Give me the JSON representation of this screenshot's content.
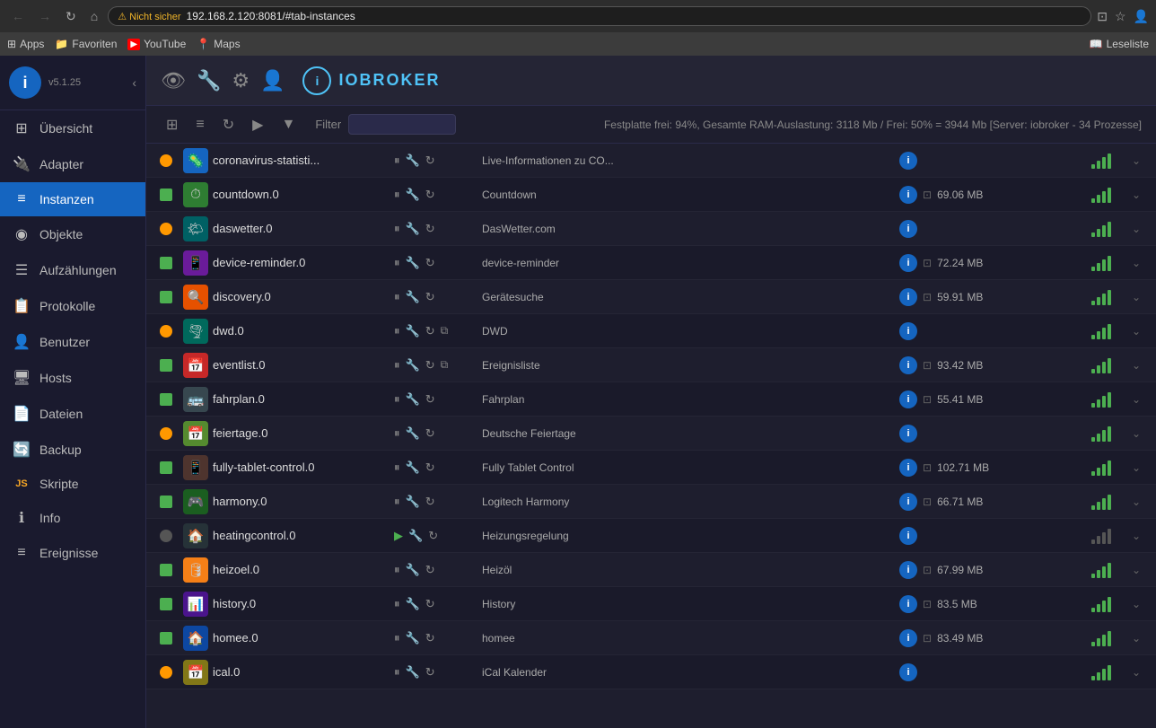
{
  "browser": {
    "back_disabled": true,
    "forward_disabled": true,
    "url": "192.168.2.120:8081/#tab-instances",
    "warning": "Nicht sicher",
    "bookmarks": [
      {
        "label": "Apps",
        "icon": "⊞",
        "color": "#555"
      },
      {
        "label": "Favoriten",
        "icon": "📁",
        "color": "#f9a825"
      },
      {
        "label": "YouTube",
        "icon": "▶",
        "color": "#ff0000"
      },
      {
        "label": "Maps",
        "icon": "📍",
        "color": "#4caf50"
      }
    ],
    "readlist_label": "Leseliste"
  },
  "sidebar": {
    "version": "v5.1.25",
    "items": [
      {
        "label": "Übersicht",
        "icon": "⊞"
      },
      {
        "label": "Adapter",
        "icon": "🔌"
      },
      {
        "label": "Instanzen",
        "icon": "≡",
        "active": true
      },
      {
        "label": "Objekte",
        "icon": "◉"
      },
      {
        "label": "Aufzählungen",
        "icon": "☰"
      },
      {
        "label": "Protokolle",
        "icon": "📋"
      },
      {
        "label": "Benutzer",
        "icon": "👤"
      },
      {
        "label": "Hosts",
        "icon": "🖥"
      },
      {
        "label": "Dateien",
        "icon": "📄"
      },
      {
        "label": "Backup",
        "icon": "🔄"
      },
      {
        "label": "Skripte",
        "icon": "JS"
      },
      {
        "label": "Info",
        "icon": "ℹ"
      },
      {
        "label": "Ereignisse",
        "icon": "≡"
      }
    ]
  },
  "topbar": {
    "icons": [
      "👁",
      "🔧",
      "⚙",
      "👤"
    ],
    "brand_letter": "i",
    "brand_name": "IOBROKER"
  },
  "toolbar": {
    "status_text": "Festplatte frei: 94%, Gesamte RAM-Auslastung: 3118 Mb / Frei: 50% = 3944 Mb [Server: iobroker - 34 Prozesse]",
    "filter_label": "Filter"
  },
  "instances": [
    {
      "status": "orange",
      "name": "coronavirus-statisti...",
      "title": "Live-Informationen zu CO...",
      "ram": "",
      "has_link": false,
      "row_alt": false
    },
    {
      "status": "green",
      "name": "countdown.0",
      "title": "Countdown",
      "ram": "69.06 MB",
      "has_link": false,
      "row_alt": true
    },
    {
      "status": "orange",
      "name": "daswetter.0",
      "title": "DasWetter.com",
      "ram": "",
      "has_link": false,
      "row_alt": false
    },
    {
      "status": "green",
      "name": "device-reminder.0",
      "title": "device-reminder",
      "ram": "72.24 MB",
      "has_link": false,
      "row_alt": true
    },
    {
      "status": "green",
      "name": "discovery.0",
      "title": "Gerätesuche",
      "ram": "59.91 MB",
      "has_link": false,
      "row_alt": false
    },
    {
      "status": "orange",
      "name": "dwd.0",
      "title": "DWD",
      "ram": "",
      "has_link": true,
      "row_alt": true
    },
    {
      "status": "green",
      "name": "eventlist.0",
      "title": "Ereignisliste",
      "ram": "93.42 MB",
      "has_link": true,
      "row_alt": false
    },
    {
      "status": "green",
      "name": "fahrplan.0",
      "title": "Fahrplan",
      "ram": "55.41 MB",
      "has_link": false,
      "row_alt": true
    },
    {
      "status": "orange",
      "name": "feiertage.0",
      "title": "Deutsche Feiertage",
      "ram": "",
      "has_link": false,
      "row_alt": false
    },
    {
      "status": "green",
      "name": "fully-tablet-control.0",
      "title": "Fully Tablet Control",
      "ram": "102.71 MB",
      "has_link": false,
      "row_alt": true
    },
    {
      "status": "green",
      "name": "harmony.0",
      "title": "Logitech Harmony",
      "ram": "66.71 MB",
      "has_link": false,
      "row_alt": false
    },
    {
      "status": "gray",
      "name": "heatingcontrol.0",
      "title": "Heizungsregelung",
      "ram": "",
      "has_link": false,
      "row_alt": true
    },
    {
      "status": "green",
      "name": "heizoel.0",
      "title": "Heizöl",
      "ram": "67.99 MB",
      "has_link": false,
      "row_alt": false
    },
    {
      "status": "green",
      "name": "history.0",
      "title": "History",
      "ram": "83.5 MB",
      "has_link": false,
      "row_alt": true
    },
    {
      "status": "green",
      "name": "homee.0",
      "title": "homee",
      "ram": "83.49 MB",
      "has_link": false,
      "row_alt": false
    },
    {
      "status": "orange",
      "name": "ical.0",
      "title": "iCal Kalender",
      "ram": "",
      "has_link": false,
      "row_alt": true
    }
  ]
}
